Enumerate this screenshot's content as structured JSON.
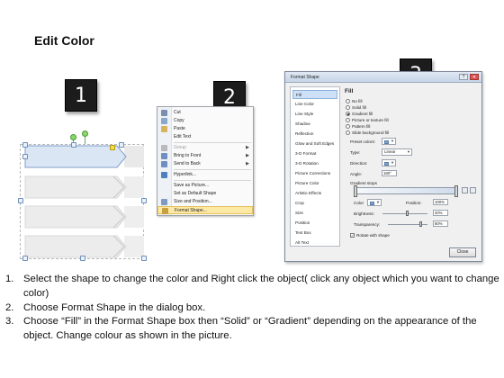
{
  "page": {
    "title": "Edit Color",
    "steps": [
      "1",
      "2",
      "3"
    ]
  },
  "context_menu": {
    "items": [
      {
        "label": "Cut",
        "icon": "scissors-icon",
        "color": "#7a8fb0",
        "disabled": false,
        "submenu": false
      },
      {
        "label": "Copy",
        "icon": "copy-icon",
        "color": "#8aa8cc",
        "disabled": false,
        "submenu": false
      },
      {
        "label": "Paste",
        "icon": "paste-icon",
        "color": "#d7b35a",
        "disabled": false,
        "submenu": false
      },
      {
        "label": "Edit Text",
        "icon": "",
        "color": "",
        "disabled": false,
        "submenu": false
      },
      {
        "label": "Group",
        "icon": "group-icon",
        "color": "#b9b9b9",
        "disabled": true,
        "submenu": true
      },
      {
        "label": "Bring to Front",
        "icon": "bring-front-icon",
        "color": "#6f8fc0",
        "disabled": false,
        "submenu": true
      },
      {
        "label": "Send to Back",
        "icon": "send-back-icon",
        "color": "#6f8fc0",
        "disabled": false,
        "submenu": true
      },
      {
        "label": "Hyperlink...",
        "icon": "link-icon",
        "color": "#4e7fbf",
        "disabled": false,
        "submenu": false
      },
      {
        "label": "Save as Picture...",
        "icon": "",
        "color": "",
        "disabled": false,
        "submenu": false
      },
      {
        "label": "Set as Default Shape",
        "icon": "",
        "color": "",
        "disabled": false,
        "submenu": false
      },
      {
        "label": "Size and Position...",
        "icon": "size-icon",
        "color": "#7f9bc4",
        "disabled": false,
        "submenu": false
      },
      {
        "label": "Format Shape...",
        "icon": "format-icon",
        "color": "#c7a13f",
        "disabled": false,
        "submenu": false,
        "highlight": true
      }
    ]
  },
  "dialog": {
    "title": "Format Shape",
    "nav": [
      "Fill",
      "Line Color",
      "Line Style",
      "Shadow",
      "Reflection",
      "Glow and Soft Edges",
      "3-D Format",
      "3-D Rotation",
      "Picture Corrections",
      "Picture Color",
      "Artistic Effects",
      "Crop",
      "Size",
      "Position",
      "Text Box",
      "Alt Text"
    ],
    "fill": {
      "heading": "Fill",
      "options": [
        "No fill",
        "Solid fill",
        "Gradient fill",
        "Picture or texture fill",
        "Pattern fill",
        "Slide background fill"
      ],
      "selected": "Gradient fill",
      "preset_label": "Preset colors:",
      "type_label": "Type:",
      "type_value": "Linear",
      "direction_label": "Direction:",
      "angle_label": "Angle:",
      "angle_value": "180°",
      "stops_label": "Gradient stops",
      "color_label": "Color",
      "position_label": "Position:",
      "position_value": "100%",
      "brightness_label": "Brightness:",
      "brightness_value": "40%",
      "transparency_label": "Transparency:",
      "transparency_value": "80%",
      "rotate_label": "Rotate with shape"
    },
    "close_label": "Close"
  },
  "instructions": [
    {
      "num": "1.",
      "text": "Select the shape to change the color and Right click the object( click any object which you want to change color)"
    },
    {
      "num": "2.",
      "text": "Choose Format Shape in the dialog box."
    },
    {
      "num": "3.",
      "text": "Choose “Fill” in the Format Shape box then “Solid” or “Gradient” depending on the appearance of the object. Change colour as shown in the picture."
    }
  ]
}
